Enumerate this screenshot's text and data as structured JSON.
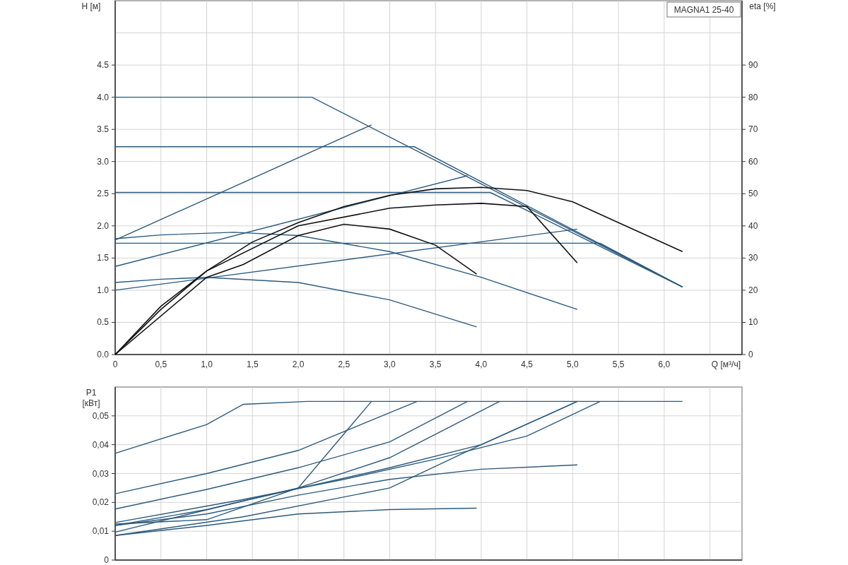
{
  "head_chart": {
    "model": "MAGNA1 25-40",
    "chart_data": {
      "type": "line",
      "xlabel": "Q [м³/ч]",
      "ylabel": "H [м]",
      "y2label": "eta [%]",
      "grid": true,
      "xlim": [
        0,
        6.85
      ],
      "ylim": [
        0,
        5.5
      ],
      "y2lim": [
        0,
        110
      ],
      "xticks": [
        0,
        {
          "value": 0.5,
          "label": "0,5"
        },
        {
          "value": 1,
          "label": "1,0"
        },
        {
          "value": 1.5,
          "label": "1,5"
        },
        {
          "value": 2,
          "label": "2,0"
        },
        {
          "value": 2.5,
          "label": "2,5"
        },
        {
          "value": 3,
          "label": "3,0"
        },
        {
          "value": 3.5,
          "label": "3,5"
        },
        {
          "value": 4,
          "label": "4,0"
        },
        {
          "value": 4.5,
          "label": "4,5"
        },
        {
          "value": 5,
          "label": "5,0"
        },
        {
          "value": 5.5,
          "label": "5,5"
        },
        {
          "value": 6,
          "label": "6,0"
        }
      ],
      "yticks": [
        {
          "value": 0,
          "label": "0.0"
        },
        {
          "value": 0.5,
          "label": "0.5"
        },
        {
          "value": 1,
          "label": "1.0"
        },
        {
          "value": 1.5,
          "label": "1.5"
        },
        {
          "value": 2,
          "label": "2.0"
        },
        {
          "value": 2.5,
          "label": "2.5"
        },
        {
          "value": 3,
          "label": "3.0"
        },
        {
          "value": 3.5,
          "label": "3.5"
        },
        {
          "value": 4,
          "label": "4.0"
        },
        {
          "value": 4.5,
          "label": "4.5"
        }
      ],
      "y2ticks": [
        0,
        10,
        20,
        30,
        40,
        50,
        60,
        70,
        80,
        90
      ],
      "series": [
        {
          "color": "#2b5a7e",
          "x": [
            0,
            2.15,
            6.2
          ],
          "values": [
            4.0,
            4.0,
            1.05
          ]
        },
        {
          "color": "#2b5a7e",
          "x": [
            0,
            3.27,
            6.2
          ],
          "values": [
            3.23,
            3.23,
            1.05
          ]
        },
        {
          "color": "#2b5a7e",
          "x": [
            0,
            4.1,
            6.2
          ],
          "values": [
            2.52,
            2.52,
            1.05
          ]
        },
        {
          "color": "#2b5a7e",
          "x": [
            0,
            5.3,
            6.2
          ],
          "values": [
            1.73,
            1.73,
            1.05
          ]
        },
        {
          "color": "#2b5a7e",
          "x": [
            0,
            2.8
          ],
          "values": [
            1.78,
            3.57
          ]
        },
        {
          "color": "#2b5a7e",
          "x": [
            0,
            3.85
          ],
          "values": [
            1.37,
            2.78
          ]
        },
        {
          "color": "#2b5a7e",
          "x": [
            0,
            5.05
          ],
          "values": [
            1.0,
            1.95
          ]
        },
        {
          "color": "#2b5a7e",
          "x": [
            0,
            0.5,
            1.3,
            2,
            3,
            4,
            5.05
          ],
          "values": [
            1.8,
            1.86,
            1.9,
            1.85,
            1.6,
            1.2,
            0.7
          ]
        },
        {
          "color": "#2b5a7e",
          "x": [
            0,
            0.5,
            1,
            2,
            3,
            3.95
          ],
          "values": [
            1.12,
            1.17,
            1.2,
            1.12,
            0.85,
            0.43
          ]
        },
        {
          "axis": "y2",
          "color": "#111111",
          "x": [
            0,
            0.5,
            1,
            1.5,
            2,
            2.5,
            3,
            3.5,
            4,
            4.5,
            5,
            5.5,
            6.2
          ],
          "values": [
            0,
            15,
            26,
            35,
            41,
            46,
            49.5,
            51.5,
            52,
            51,
            47.5,
            41,
            32
          ]
        },
        {
          "axis": "y2",
          "color": "#111111",
          "x": [
            0,
            0.5,
            1,
            2,
            3,
            3.5,
            4,
            4.5,
            5.05
          ],
          "values": [
            0,
            14,
            26,
            40,
            45.5,
            46.5,
            47,
            46,
            28.5
          ]
        },
        {
          "axis": "y2",
          "color": "#111111",
          "x": [
            0,
            1,
            1.4,
            2,
            2.5,
            3,
            3.5,
            3.95
          ],
          "values": [
            0,
            24,
            28,
            37,
            40.5,
            39,
            34,
            25
          ]
        }
      ]
    }
  },
  "power_chart": {
    "chart_data": {
      "type": "line",
      "ylabel": "P1 [кВт]",
      "grid": true,
      "xlim": [
        0,
        6.85
      ],
      "ylim": [
        0,
        0.06
      ],
      "yticks": [
        {
          "value": 0,
          "label": "0"
        },
        {
          "value": 0.01,
          "label": "0,01"
        },
        {
          "value": 0.02,
          "label": "0,02"
        },
        {
          "value": 0.03,
          "label": "0,03"
        },
        {
          "value": 0.04,
          "label": "0,04"
        },
        {
          "value": 0.05,
          "label": "0,05"
        }
      ],
      "series": [
        {
          "color": "#2b5a7e",
          "x": [
            0,
            1,
            1.4,
            2.1,
            6.2
          ],
          "values": [
            0.037,
            0.047,
            0.054,
            0.055,
            0.055
          ]
        },
        {
          "color": "#2b5a7e",
          "x": [
            0,
            1,
            2,
            3.3
          ],
          "values": [
            0.023,
            0.03,
            0.038,
            0.055
          ]
        },
        {
          "color": "#2b5a7e",
          "x": [
            0,
            1,
            2,
            3,
            3.85
          ],
          "values": [
            0.0177,
            0.0245,
            0.032,
            0.041,
            0.055
          ]
        },
        {
          "color": "#2b5a7e",
          "x": [
            0,
            1,
            2,
            2.8
          ],
          "values": [
            0.0125,
            0.014,
            0.025,
            0.055
          ]
        },
        {
          "color": "#2b5a7e",
          "x": [
            0,
            1,
            2,
            3,
            4.2
          ],
          "values": [
            0.012,
            0.0175,
            0.025,
            0.0355,
            0.055
          ]
        },
        {
          "color": "#2b5a7e",
          "x": [
            0,
            1.4,
            2.5,
            3.5,
            4.5,
            5.3
          ],
          "values": [
            0.013,
            0.021,
            0.028,
            0.035,
            0.043,
            0.055
          ]
        },
        {
          "color": "#2b5a7e",
          "x": [
            0,
            1,
            2,
            3,
            4,
            5.05
          ],
          "values": [
            0.012,
            0.016,
            0.0225,
            0.028,
            0.0315,
            0.033
          ]
        },
        {
          "color": "#2b5a7e",
          "x": [
            0,
            1.4,
            3,
            4,
            5.05
          ],
          "values": [
            0.0097,
            0.0205,
            0.032,
            0.04,
            0.055
          ]
        },
        {
          "color": "#2b5a7e",
          "x": [
            0,
            1,
            2,
            3,
            3.95
          ],
          "values": [
            0.0085,
            0.012,
            0.016,
            0.0175,
            0.018
          ]
        },
        {
          "color": "#2b5a7e",
          "x": [
            0,
            1.4,
            3,
            4,
            5.05
          ],
          "values": [
            0.0085,
            0.015,
            0.025,
            0.04,
            0.055
          ]
        }
      ]
    }
  }
}
